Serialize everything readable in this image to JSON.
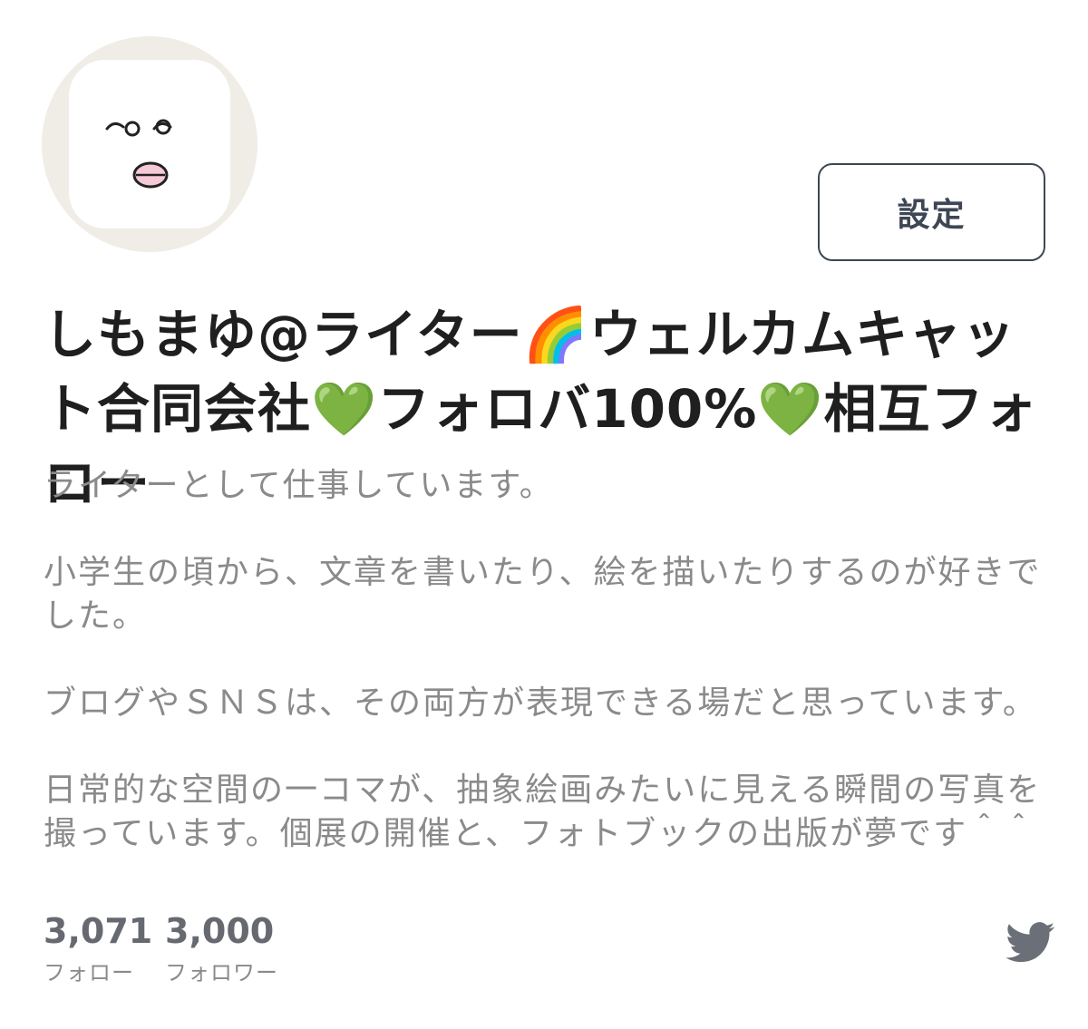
{
  "profile": {
    "display_name": "しもまゆ@ライター🌈ウェルカムキャット合同会社💚フォロバ100%💚相互フォロー",
    "settings_label": "設定",
    "bio": [
      "ライターとして仕事しています。",
      "小学生の頃から、文章を書いたり、絵を描いたりするのが好きでした。",
      "ブログやＳＮＳは、その両方が表現できる場だと思っています。",
      "日常的な空間の一コマが、抽象絵画みたいに見える瞬間の写真を撮っています。個展の開催と、フォトブックの出版が夢です＾＾"
    ]
  },
  "stats": {
    "following_count": "3,071",
    "following_label": "フォロー",
    "followers_count": "3,000",
    "followers_label": "フォロワー"
  },
  "icons": {
    "avatar": "face-illustration",
    "social": "twitter-bird-icon"
  },
  "colors": {
    "avatar_background": "#efede6",
    "button_border": "#3d4654",
    "twitter_icon": "#6b7078",
    "bio_text": "#8a8a8a"
  }
}
